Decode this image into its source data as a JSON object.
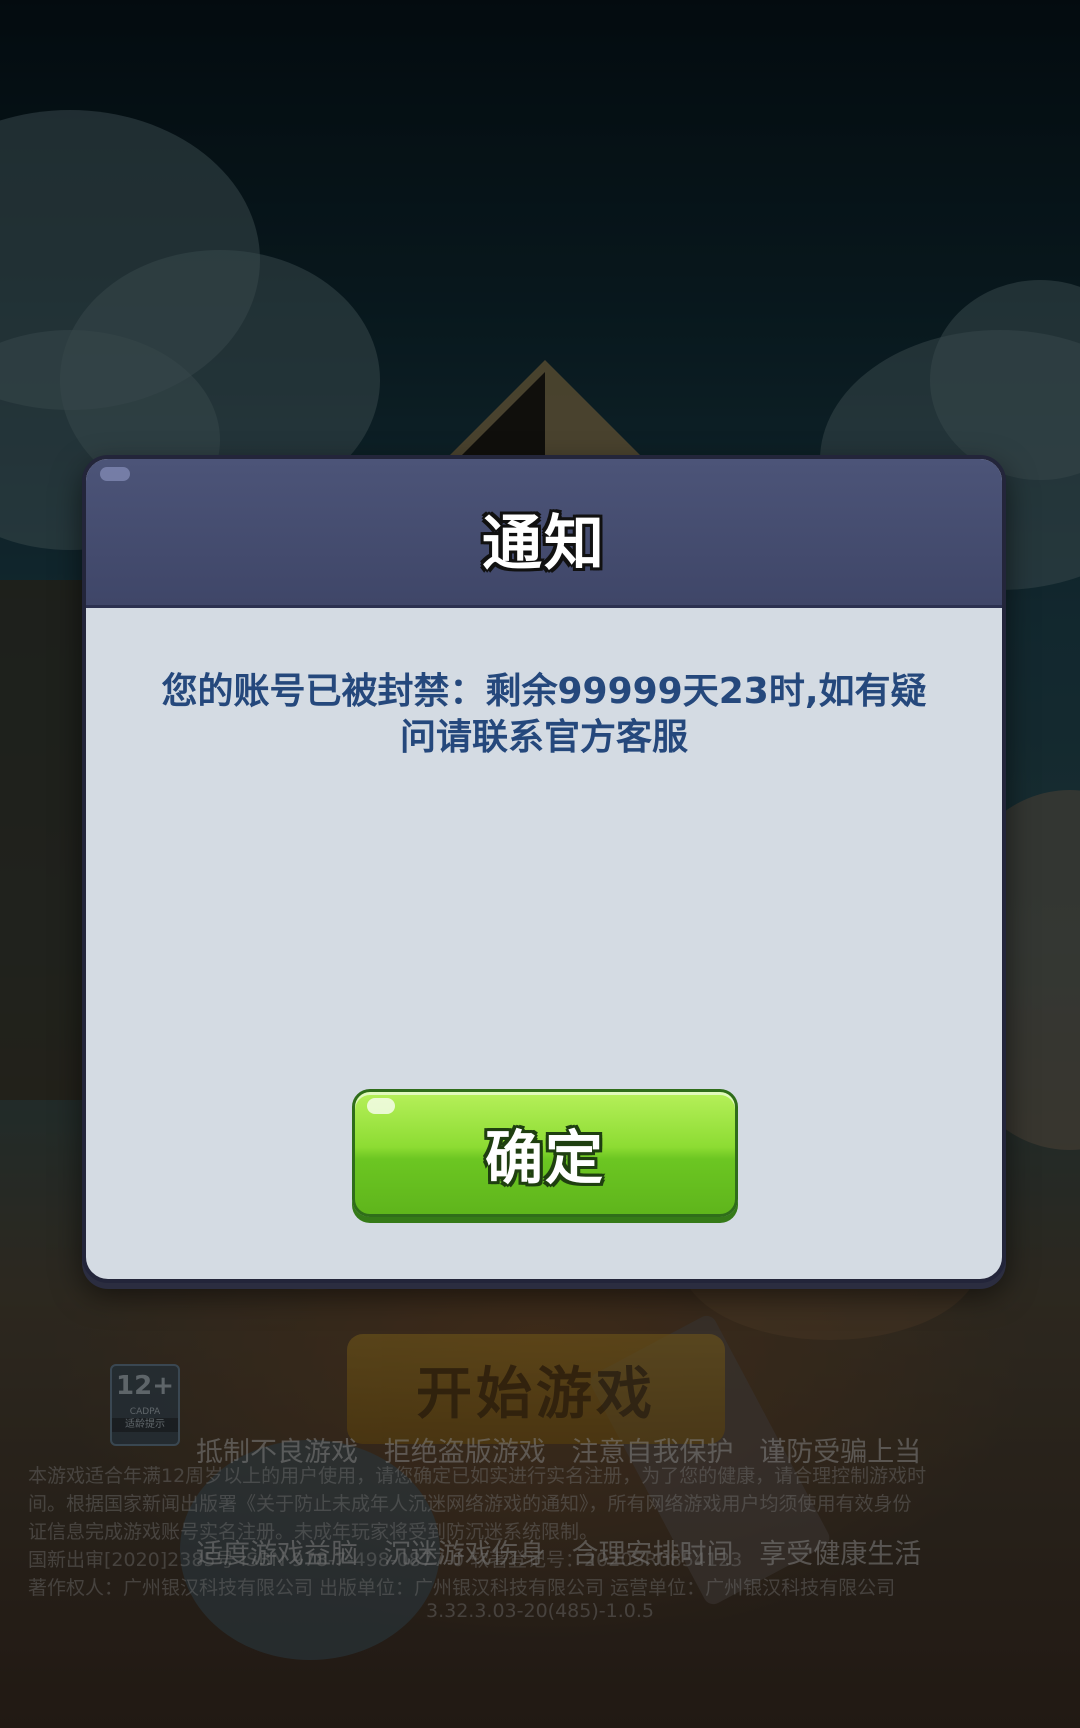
{
  "background": {
    "start_button_label": "开始游戏",
    "age_rating": {
      "number": "12+",
      "org": "CADPA",
      "tip": "适龄提示"
    },
    "health_notice": {
      "line1": "抵制不良游戏   拒绝盗版游戏   注意自我保护   谨防受骗上当",
      "line2": "适度游戏益脑   沉迷游戏伤身   合理安排时间   享受健康生活"
    },
    "legal_lines": [
      "本游戏适合年满12周岁以上的用户使用，请您确定已如实进行实名注册，为了您的健康，请合理控制游戏时",
      "间。根据国家新闻出版署《关于防止未成年人沉迷网络游戏的通知》，所有网络游戏用户均须使用有效身份",
      "证信息完成游戏账号实名注册。未成年玩家将受到防沉迷系统限制。",
      "国新出审[2020]2385号   ISBN 978-7-498-0877-0   软著登记号：2020SR0854123",
      "著作权人：广州银汉科技有限公司   出版单位：广州银汉科技有限公司   运营单位：广州银汉科技有限公司"
    ],
    "version": "3.32.3.03-20(485)-1.0.5"
  },
  "dialog": {
    "title": "通知",
    "message": "您的账号已被封禁：剩余99999天23时,如有疑问请联系官方客服",
    "confirm_label": "确定"
  },
  "colors": {
    "dialog_header": "#424a6e",
    "dialog_body": "#d4dbe3",
    "message_text": "#25487c",
    "confirm_green": "#7dd22c"
  }
}
